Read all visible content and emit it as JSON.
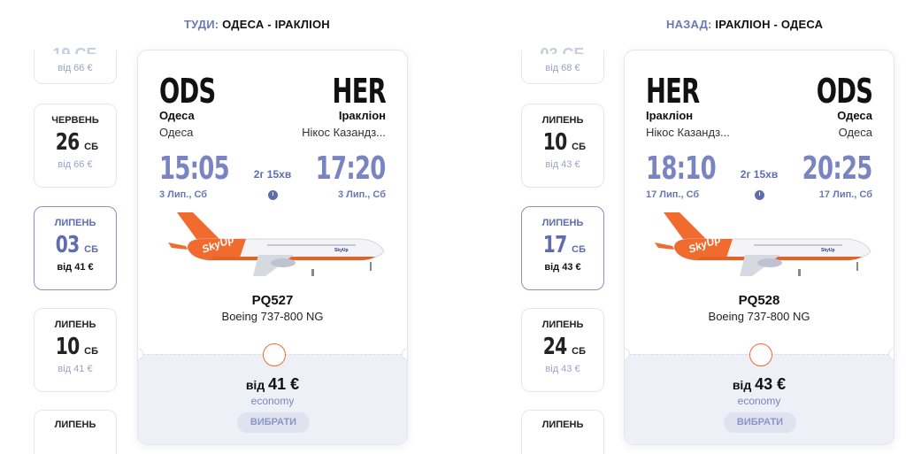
{
  "outbound": {
    "title_prefix": "ТУДИ:",
    "title_route": "ОДЕСА - ІРАКЛІОН",
    "dates": [
      {
        "price": "від 66 €"
      },
      {
        "month": "ЧЕРВЕНЬ",
        "day": "26",
        "weekday": "СБ",
        "price": "від 66 €"
      },
      {
        "month": "ЛИПЕНЬ",
        "day": "03",
        "weekday": "СБ",
        "price": "від 41 €"
      },
      {
        "month": "ЛИПЕНЬ",
        "day": "10",
        "weekday": "СБ",
        "price": "від 41 €"
      },
      {
        "month": "ЛИПЕНЬ"
      }
    ],
    "flight": {
      "from_code": "ODS",
      "to_code": "HER",
      "from_city": "Одеса",
      "to_city": "Іракліон",
      "from_airport": "Одеса",
      "to_airport": "Нікос Казандз...",
      "dep_time": "15:05",
      "arr_time": "17:20",
      "dep_date": "3 Лип., Сб",
      "arr_date": "3 Лип., Сб",
      "duration": "2г 15хв",
      "number": "PQ527",
      "aircraft": "Boeing 737-800 NG",
      "price_prefix": "від",
      "price_amount": "41 €",
      "fare_class": "economy",
      "select_label": "ВИБРАТИ"
    }
  },
  "return": {
    "title_prefix": "НАЗАД:",
    "title_route": "ІРАКЛІОН - ОДЕСА",
    "dates": [
      {
        "price": "від 68 €"
      },
      {
        "month": "ЛИПЕНЬ",
        "day": "10",
        "weekday": "СБ",
        "price": "від 43 €"
      },
      {
        "month": "ЛИПЕНЬ",
        "day": "17",
        "weekday": "СБ",
        "price": "від 43 €"
      },
      {
        "month": "ЛИПЕНЬ",
        "day": "24",
        "weekday": "СБ",
        "price": "від 43 €"
      },
      {
        "month": "ЛИПЕНЬ"
      }
    ],
    "flight": {
      "from_code": "HER",
      "to_code": "ODS",
      "from_city": "Іракліон",
      "to_city": "Одеса",
      "from_airport": "Нікос Казандз...",
      "to_airport": "Одеса",
      "dep_time": "18:10",
      "arr_time": "20:25",
      "dep_date": "17 Лип., Сб",
      "arr_date": "17 Лип., Сб",
      "duration": "2г 15хв",
      "number": "PQ528",
      "aircraft": "Boeing 737-800 NG",
      "price_prefix": "від",
      "price_amount": "43 €",
      "fare_class": "economy",
      "select_label": "ВИБРАТИ"
    }
  },
  "colors": {
    "accent": "#7a84c2",
    "accent_dark": "#5f6cb0",
    "brand_orange": "#f26b2e",
    "card_bottom": "#eef0f7"
  },
  "icons": {
    "duration": "clock-icon",
    "aircraft": "airplane-image"
  }
}
